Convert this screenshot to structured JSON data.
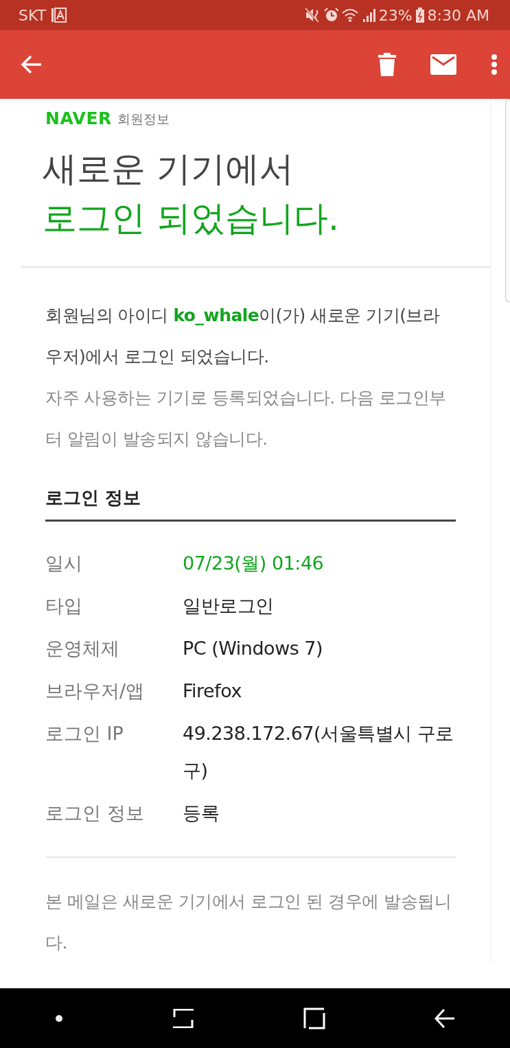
{
  "status_bar": {
    "carrier": "SKT",
    "battery": "23%",
    "time": "8:30 AM"
  },
  "mail": {
    "brand": "NAVER",
    "brand_section": "회원정보",
    "headline_1": "새로운 기기에서",
    "headline_2": "로그인 되었습니다.",
    "intro": "회원님의 아이디 **ko_whale**이(가) 새로운 기기(브라우저)에서 로그인 되었습니다.",
    "note": "자주 사용하는 기기로 등록되었습니다. 다음 로그인부터 알림이 발송되지 않습니다.",
    "section_title": "로그인 정보",
    "rows": [
      {
        "label": "일시",
        "value": "07/23(월) 01:46",
        "highlight": true
      },
      {
        "label": "타입",
        "value": "일반로그인",
        "highlight": false
      },
      {
        "label": "운영체제",
        "value": "PC (Windows 7)",
        "highlight": false
      },
      {
        "label": "브라우저/앱",
        "value": "Firefox",
        "highlight": false
      },
      {
        "label": "로그인 IP",
        "value": "49.238.172.67(서울특별시 구로구)",
        "highlight": false
      },
      {
        "label": "로그인 정보",
        "value": "등록",
        "highlight": false
      }
    ],
    "footer": "본 메일은 새로운 기기에서 로그인 된 경우에 발송됩니다."
  }
}
